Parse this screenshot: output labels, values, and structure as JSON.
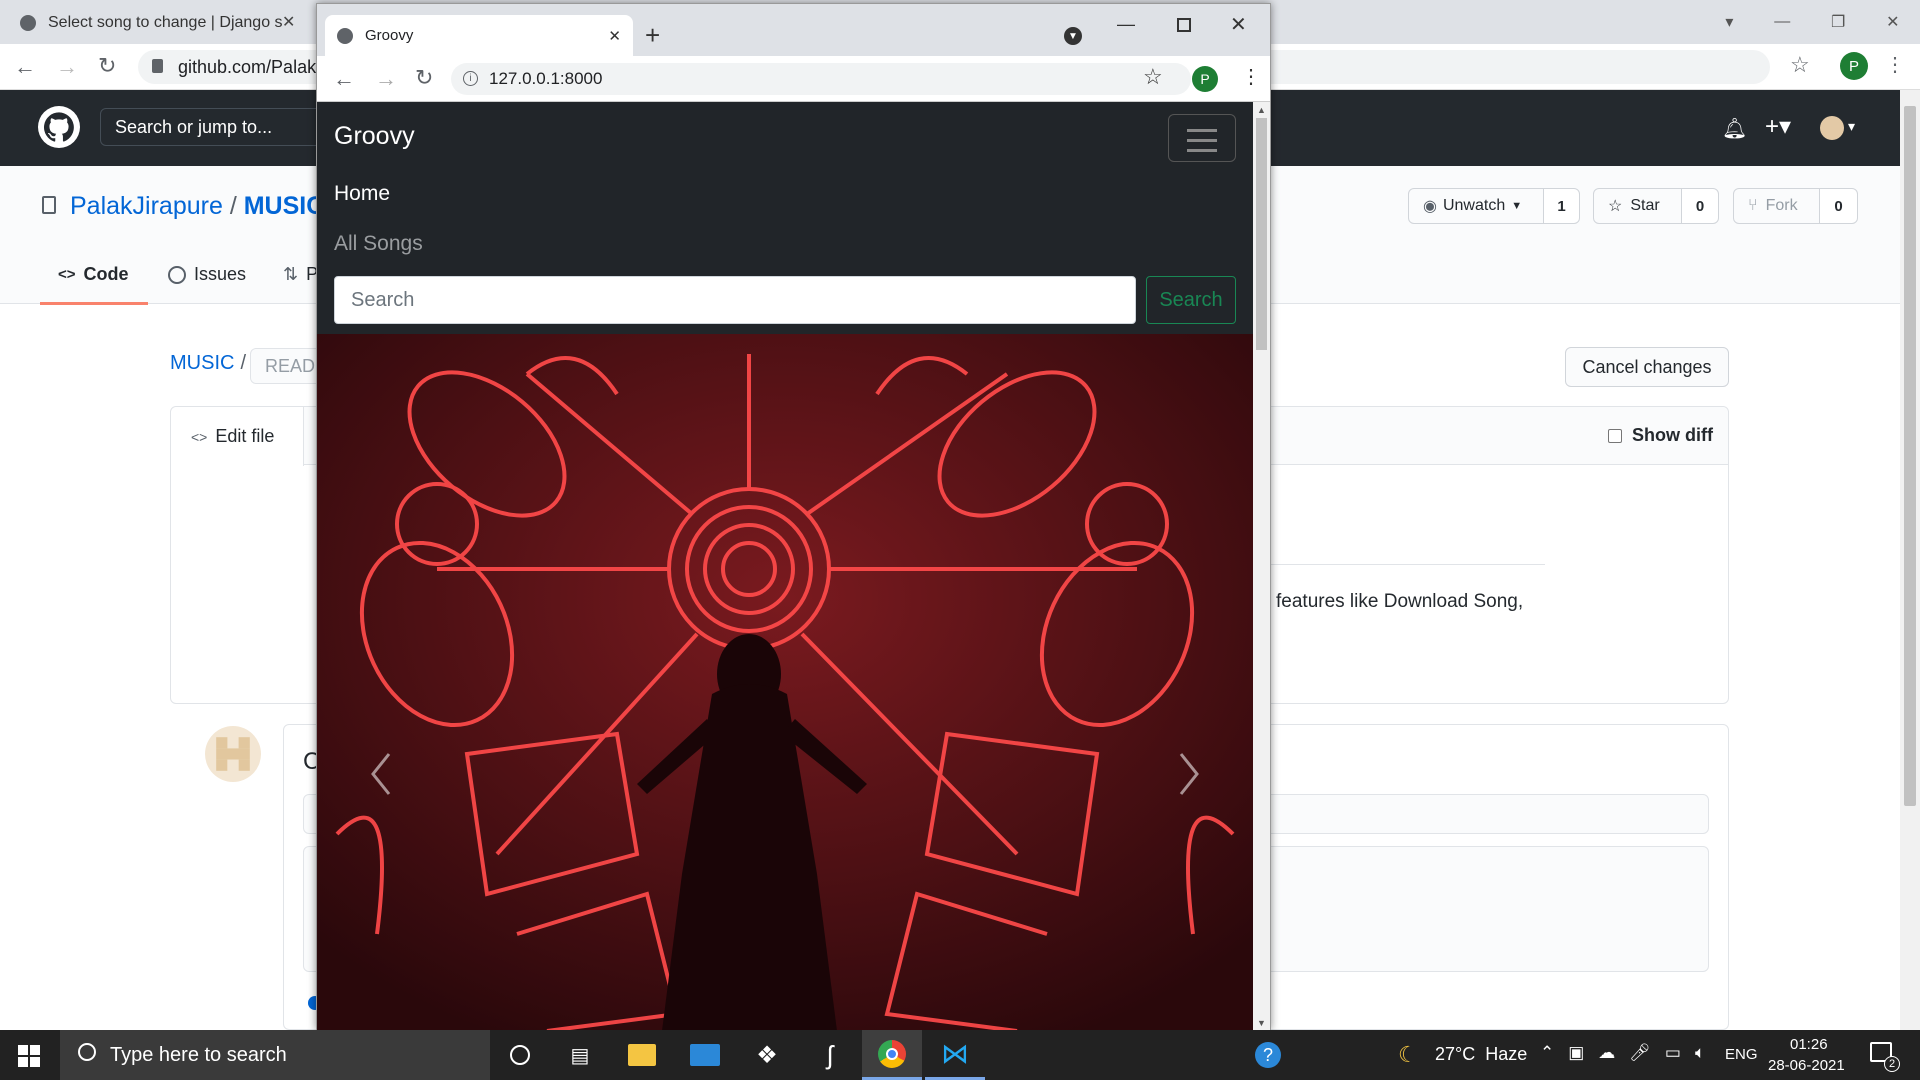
{
  "bg_browser": {
    "tab_title": "Select song to change | Django s",
    "url": "github.com/PalakJ"
  },
  "github": {
    "search_placeholder": "Search or jump to...",
    "owner": "PalakJirapure",
    "separator": "/",
    "repo": "MUSIC",
    "unwatch_label": "Unwatch",
    "unwatch_count": "1",
    "star_label": "Star",
    "star_count": "0",
    "fork_label": "Fork",
    "fork_count": "0",
    "tabs": [
      {
        "label": "Code"
      },
      {
        "label": "Issues"
      },
      {
        "label": "P"
      }
    ],
    "breadcrumb_repo": "MUSIC",
    "breadcrumb_sep": "/",
    "file_name": "READM",
    "cancel_label": "Cancel changes",
    "edit_file_label": "Edit file",
    "show_diff_label": "Show diff",
    "readme_fragment": "features like Download Song,",
    "commit_fragment": "C"
  },
  "front_browser": {
    "tab_title": "Groovy",
    "url": "127.0.0.1:8000",
    "profile_initial": "P"
  },
  "app": {
    "brand": "Groovy",
    "nav": [
      {
        "label": "Home"
      },
      {
        "label": "All Songs"
      }
    ],
    "search_placeholder": "Search",
    "search_button": "Search",
    "carousel_prev": "‹",
    "carousel_next": "›"
  },
  "taskbar": {
    "search_placeholder": "Type here to search",
    "weather": "27°C  Haze",
    "lang": "ENG",
    "time": "01:26",
    "date": "28-06-2021",
    "notifications": "2"
  },
  "colors": {
    "github_header": "#24292e",
    "app_navbar": "#212529",
    "search_green": "#198754",
    "neon_red": "#ff3b3b"
  }
}
